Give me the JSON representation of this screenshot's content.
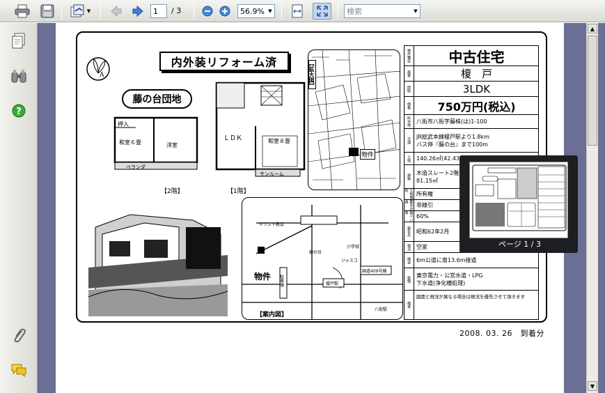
{
  "toolbar": {
    "page_current": "1",
    "page_total": "/ 3",
    "zoom_value": "56.9%",
    "search_placeholder": "検索"
  },
  "flyer": {
    "headline": "内外装リフォーム済",
    "estate_name": "藤の台団地",
    "floor_labels": {
      "second": "【2階】",
      "first": "【1階】"
    },
    "room_labels": {
      "oshiire": "押入",
      "washitsu6": "和室６畳",
      "youshitsu": "洋室",
      "veranda": "ベランダ",
      "ldk": "ＬＤＫ",
      "washitsu8": "和室８畳",
      "sunroom": "サンルーム"
    },
    "zoom_map_label": "【拡大図】",
    "zoom_map_bukken": "物件",
    "zoom_map_marker": "物件",
    "access_map_caption": "【案内図】",
    "access_map_bukken": "物件",
    "access_map_labels": {
      "chuusha": "駐車場",
      "route": "国道409号線",
      "church": "キリスト教会",
      "school": "小学校",
      "jusco": "ジャスコ",
      "fujinodai": "藤の台",
      "station": "榎戸駅",
      "yachimata": "八街駅"
    },
    "received_stamp": "2008. 03. 26　到着分"
  },
  "info_table": {
    "category_label": "物件種目",
    "title": "中古住宅",
    "location_label": "最寄",
    "location_name": "榎　戸",
    "layout_label": "間取",
    "layout": "3LDK",
    "price_label": "価格",
    "price": "750万円(税込)",
    "address_label": "所在地",
    "address": "八街市八街字藤株(は)1-100",
    "transport_label": "交通",
    "transport1": "JR総武本線榎戸駅より1.8km",
    "transport2": "バス停『藤の台』まで100m",
    "land_label": "土地",
    "land_area": "140.26㎡(42.43坪)",
    "building_label": "建物",
    "structure": "木造スレート2階建",
    "floor_area": "81.15㎡",
    "tenure_label": "土地権利",
    "tenure": "所有権",
    "zone_label": "都市計画",
    "zone": "非線引",
    "coverage_label": "建ぺい率",
    "coverage": "60%",
    "built_label": "築年月",
    "built": "昭和62年2月",
    "status_label": "現況",
    "status": "空家",
    "road_label": "接道",
    "road": "6m公道に南13.6m接道",
    "facilities_label": "設備",
    "facilities1": "東京電力・公営水道・LPG",
    "facilities2": "下水道(浄化槽処理)",
    "note_label": "備考",
    "note": "図面と現況が異なる場合は現況を優先させて頂きます"
  },
  "thumbnail_popup": {
    "label": "ページ 1 / 3"
  },
  "colors": {
    "page_background": "#6b6f95",
    "toolbar_bg": "#e6e6e0",
    "help_green": "#3aa83a",
    "popup_bg": "#1e1f23"
  },
  "icons": [
    "print-icon",
    "save-icon",
    "sign-icon",
    "prev-page-icon",
    "next-page-icon",
    "zoom-out-icon",
    "zoom-in-icon",
    "fit-width-icon",
    "full-screen-icon",
    "pages-icon",
    "binoculars-icon",
    "help-icon",
    "paperclip-icon",
    "comment-icon"
  ]
}
